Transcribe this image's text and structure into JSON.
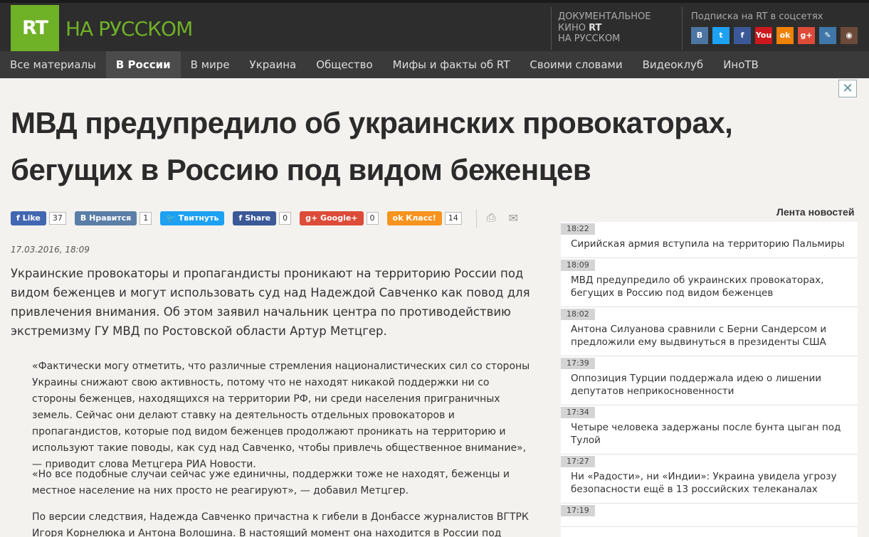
{
  "header": {
    "logo_mark": "RT",
    "logo_text": "НА РУССКОМ",
    "doc_line1": "ДОКУМЕНТАЛЬНОЕ",
    "doc_line2a": "КИНО",
    "doc_line2b": "RT",
    "doc_line3": "НА РУССКОМ",
    "subscribe_label": "Подписка на RT в соцсетях",
    "social": [
      {
        "name": "vk-icon",
        "glyph": "В",
        "color": "#4c75a3"
      },
      {
        "name": "twitter-icon",
        "glyph": "t",
        "color": "#1da1f2"
      },
      {
        "name": "facebook-icon",
        "glyph": "f",
        "color": "#3b5998"
      },
      {
        "name": "youtube-icon",
        "glyph": "You",
        "color": "#cc181e"
      },
      {
        "name": "odnoklassniki-icon",
        "glyph": "ok",
        "color": "#ee8208"
      },
      {
        "name": "googleplus-icon",
        "glyph": "g+",
        "color": "#dd4b39"
      },
      {
        "name": "livejournal-icon",
        "glyph": "✎",
        "color": "#3e77a8"
      },
      {
        "name": "instagram-icon",
        "glyph": "◉",
        "color": "#6b4a3a"
      }
    ]
  },
  "nav": {
    "items": [
      "Все материалы",
      "В России",
      "В мире",
      "Украина",
      "Общество",
      "Мифы и факты об RT",
      "Своими словами",
      "Видеоклуб",
      "ИноТВ"
    ],
    "active_index": 1
  },
  "close_glyph": "✕",
  "article": {
    "title": "МВД предупредило об украинских провокаторах, бегущих в Россию под видом беженцев",
    "share": {
      "fb_like": "Like",
      "fb_like_count": "37",
      "vk_label": "Нравится",
      "vk_count": "1",
      "tw_label": "Твитнуть",
      "fb_share": "Share",
      "fb_share_count": "0",
      "gp_label": "Google+",
      "gp_count": "0",
      "ok_label": "Класс!",
      "ok_count": "14"
    },
    "date": "17.03.2016, 18:09",
    "lead": "Украинские провокаторы и пропагандисты проникают на территорию России под видом беженцев и могут использовать суд над Надеждой Савченко как повод для привлечения внимания. Об этом заявил начальник центра по противодействию экстремизму ГУ МВД по Ростовской области Артур Метцгер.",
    "quote1": "«Фактически могу отметить, что различные стремления националистических сил со стороны Украины снижают свою активность, потому что не находят никакой поддержки ни со стороны беженцев, находящихся на территории РФ, ни среди населения приграничных земель. Сейчас они делают ставку на деятельность отдельных провокаторов и пропагандистов, которые под видом беженцев продолжают проникать на территорию и используют такие поводы, как суд над Савченко, чтобы привлечь общественное внимание», — приводит слова Метцгера РИА Новости.",
    "quote2": "«Но все подобные случаи сейчас уже единичны, поддержки тоже не находят, беженцы и местное население на них просто не реагируют», — добавил Метцгер.",
    "para3": "По версии следствия, Надежда Савченко причастна к гибели в Донбассе журналистов ВГТРК Игоря Корнелюка и Антона Волошина. В настоящий момент она находится в России под стражей."
  },
  "feed": {
    "title": "Лента новостей",
    "items": [
      {
        "time": "18:22",
        "text": "Сирийская армия вступила на территорию Пальмиры"
      },
      {
        "time": "18:09",
        "text": "МВД предупредило об украинских провокаторах, бегущих в Россию под видом беженцев"
      },
      {
        "time": "18:02",
        "text": "Антона Силуанова сравнили с Берни Сандерсом и предложили ему выдвинуться в президенты США"
      },
      {
        "time": "17:39",
        "text": "Оппозиция Турции поддержала идею о лишении депутатов неприкосновенности"
      },
      {
        "time": "17:34",
        "text": "Четыре человека задержаны после бунта цыган под Тулой"
      },
      {
        "time": "17:27",
        "text": "Ни «Радости», ни «Индии»: Украина увидела угрозу безопасности ещё в 13 российских телеканалах"
      },
      {
        "time": "17:19",
        "text": ""
      }
    ]
  }
}
